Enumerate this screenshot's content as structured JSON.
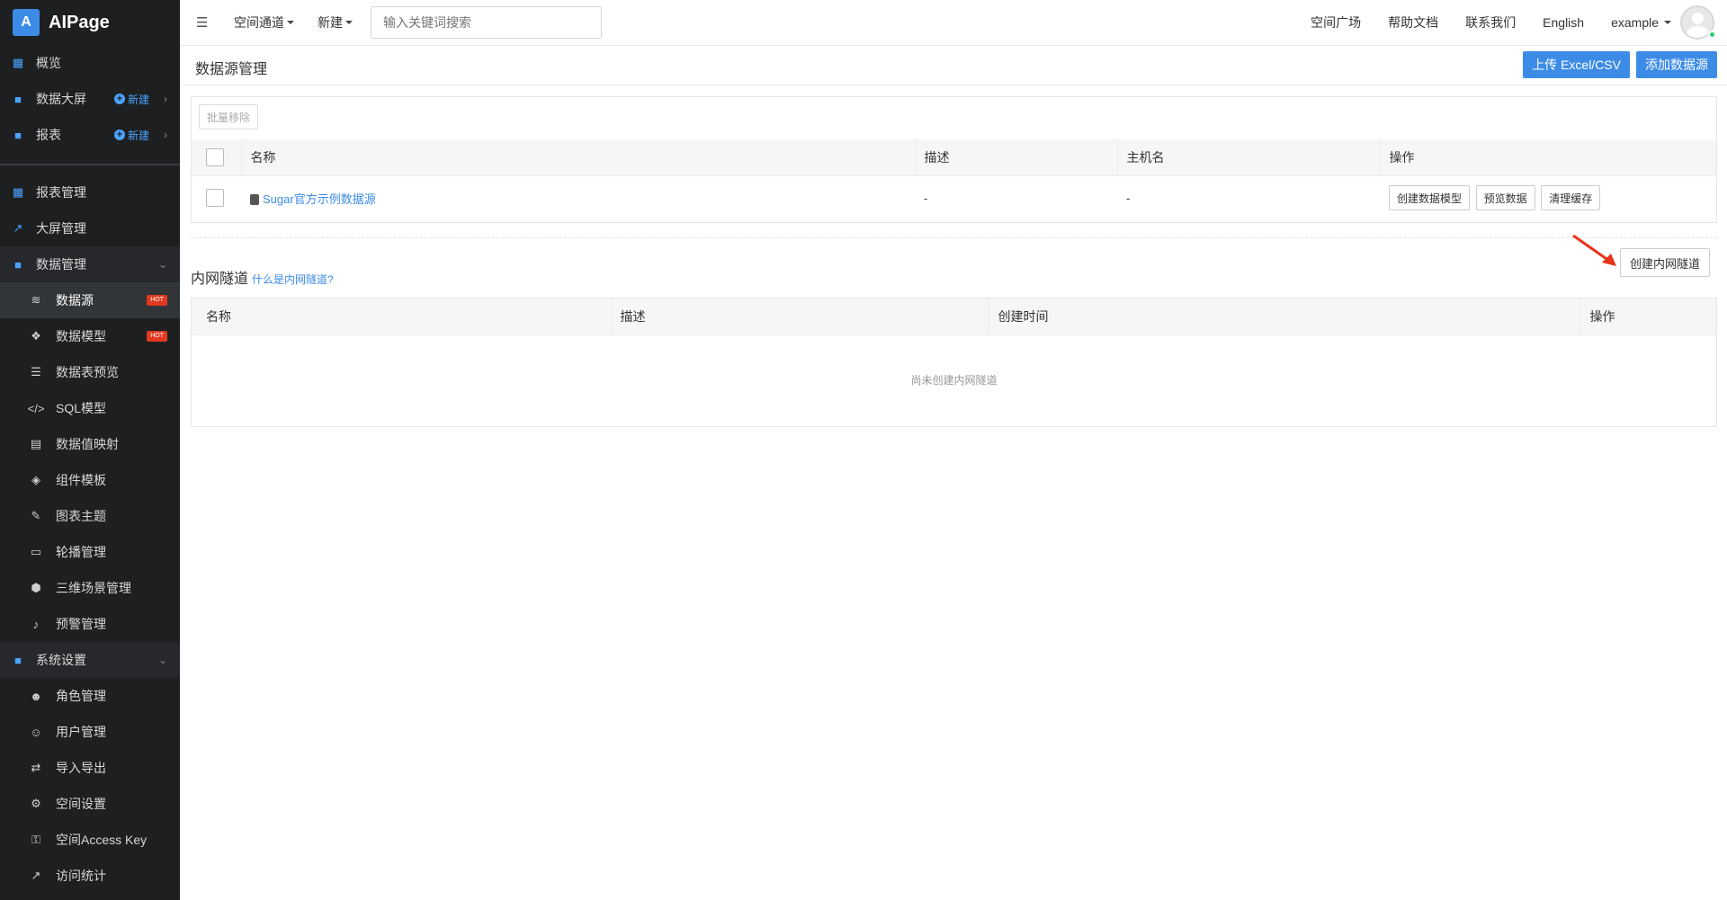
{
  "brand": {
    "logo_letter": "A",
    "name": "AIPage"
  },
  "sidebar": {
    "top_items": [
      {
        "label": "概览",
        "icon": "dashboard-icon"
      },
      {
        "label": "数据大屏",
        "icon": "folder-icon",
        "new_label": "新建"
      },
      {
        "label": "报表",
        "icon": "folder-icon",
        "new_label": "新建"
      }
    ],
    "items": [
      {
        "label": "报表管理",
        "icon": "grid-icon"
      },
      {
        "label": "大屏管理",
        "icon": "chart-line-icon"
      },
      {
        "label": "数据管理",
        "icon": "folder-icon"
      },
      {
        "label": "数据源",
        "icon": "database-icon",
        "badge": "HOT"
      },
      {
        "label": "数据模型",
        "icon": "model-icon",
        "badge": "HOT"
      },
      {
        "label": "数据表预览",
        "icon": "list-icon"
      },
      {
        "label": "SQL模型",
        "icon": "code-icon"
      },
      {
        "label": "数据值映射",
        "icon": "book-icon"
      },
      {
        "label": "组件模板",
        "icon": "cube-outline-icon"
      },
      {
        "label": "图表主题",
        "icon": "magic-wand-icon"
      },
      {
        "label": "轮播管理",
        "icon": "monitor-icon"
      },
      {
        "label": "三维场景管理",
        "icon": "cube-icon"
      },
      {
        "label": "预警管理",
        "icon": "bell-icon"
      },
      {
        "label": "系统设置",
        "icon": "folder-icon"
      },
      {
        "label": "角色管理",
        "icon": "users-icon"
      },
      {
        "label": "用户管理",
        "icon": "user-icon"
      },
      {
        "label": "导入导出",
        "icon": "exchange-icon"
      },
      {
        "label": "空间设置",
        "icon": "gear-icon"
      },
      {
        "label": "空间Access Key",
        "icon": "key-icon"
      },
      {
        "label": "访问统计",
        "icon": "chart-line-icon"
      }
    ]
  },
  "topbar": {
    "space_dropdown": "空间通道",
    "new_dropdown": "新建",
    "search_placeholder": "输入关键词搜索",
    "links": [
      "空间广场",
      "帮助文档",
      "联系我们",
      "English"
    ],
    "user": "example"
  },
  "page": {
    "title": "数据源管理",
    "upload_button": "上传 Excel/CSV",
    "add_button": "添加数据源"
  },
  "datasources": {
    "batch_remove": "批量移除",
    "columns": [
      "名称",
      "描述",
      "主机名",
      "操作"
    ],
    "rows": [
      {
        "name": "Sugar官方示例数据源",
        "desc": "-",
        "host": "-",
        "actions": [
          "创建数据模型",
          "预览数据",
          "清理缓存"
        ]
      }
    ]
  },
  "tunnel": {
    "title": "内网隧道",
    "help_link": "什么是内网隧道?",
    "create_button": "创建内网隧道",
    "columns": [
      "名称",
      "描述",
      "创建时间",
      "操作"
    ],
    "empty_text": "尚未创建内网隧道"
  },
  "colors": {
    "accent": "#3c8ce7",
    "sidebar_bg": "#1d1f21",
    "hot": "#e0391f",
    "arrow": "#e8341c"
  }
}
